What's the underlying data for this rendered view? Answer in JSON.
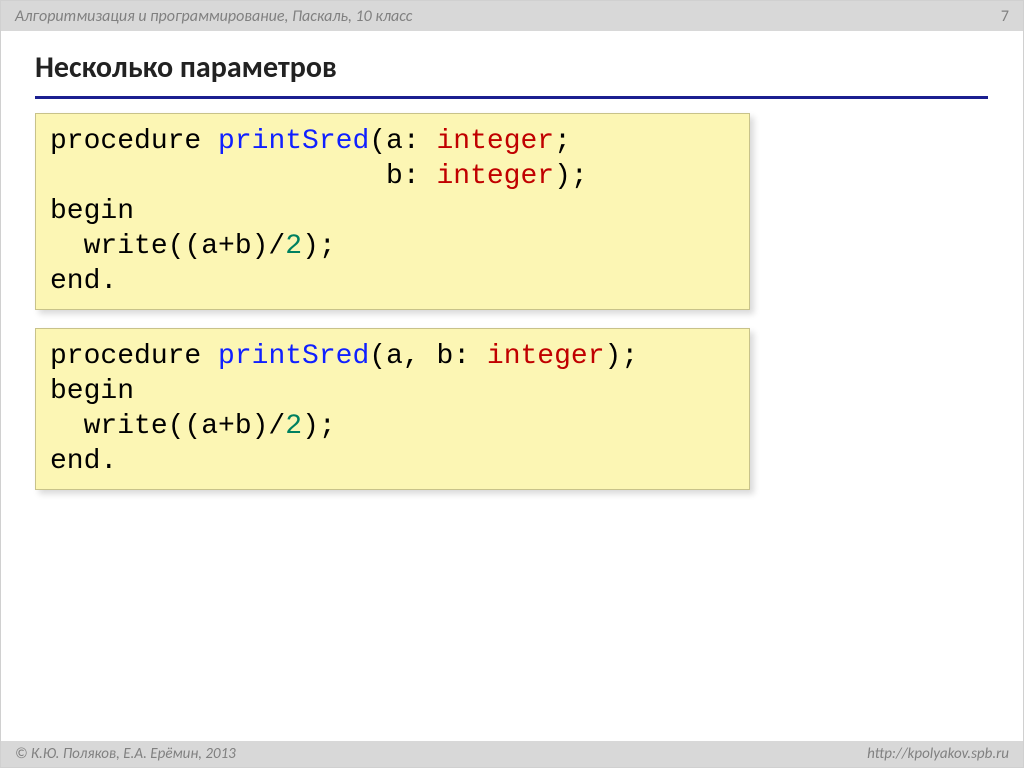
{
  "header": {
    "crumb": "Алгоритмизация и программирование, Паскаль, 10 класс",
    "page_number": "7"
  },
  "title": "Несколько параметров",
  "code1": {
    "l1a": "procedure ",
    "l1b": "printSred",
    "l1c": "(a: ",
    "l1d": "integer",
    "l1e": ";",
    "l2a": "                    b: ",
    "l2b": "integer",
    "l2c": ");",
    "l3": "begin",
    "l4a": "  write((a+b)/",
    "l4b": "2",
    "l4c": ");",
    "l5": "end."
  },
  "code2": {
    "l1a": "procedure ",
    "l1b": "printSred",
    "l1c": "(a, b: ",
    "l1d": "integer",
    "l1e": ");",
    "l2": "begin",
    "l3a": "  write((a+b)/",
    "l3b": "2",
    "l3c": ");",
    "l4": "end."
  },
  "footer": {
    "left": "© К.Ю. Поляков, Е.А. Ерёмин, 2013",
    "right": "http://kpolyakov.spb.ru"
  }
}
